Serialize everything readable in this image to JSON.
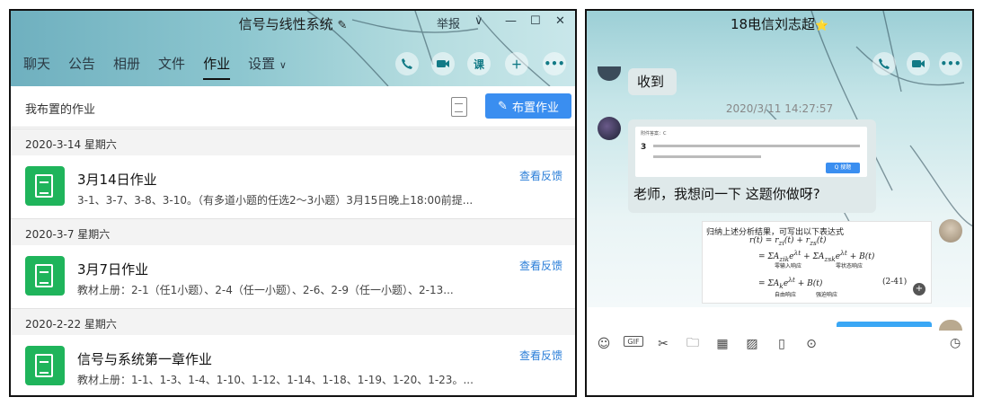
{
  "left": {
    "title": "信号与线性系统",
    "edit_icon": "pencil-icon",
    "report_label": "举报",
    "tabs": [
      "聊天",
      "公告",
      "相册",
      "文件",
      "作业",
      "设置"
    ],
    "active_tab": "作业",
    "right_buttons": [
      "phone-icon",
      "video-icon",
      "lesson-icon",
      "plus-icon",
      "more-icon"
    ],
    "lesson_label": "课",
    "subheader": "我布置的作业",
    "assign_button": "布置作业",
    "groups": [
      {
        "date": "2020-3-14 星期六",
        "title": "3月14日作业",
        "desc": "3-1、3-7、3-8、3-10。（有多道小题的任选2～3小题）3月15日晚上18:00前提...",
        "action": "查看反馈"
      },
      {
        "date": "2020-3-7 星期六",
        "title": "3月7日作业",
        "desc": "教材上册：2-1（任1小题）、2-4（任一小题）、2-6、2-9（任一小题）、2-13...",
        "action": "查看反馈"
      },
      {
        "date": "2020-2-22 星期六",
        "title": "信号与系统第一章作业",
        "desc": "教材上册：1-1、1-3、1-4、1-10、1-12、1-14、1-18、1-19、1-20、1-23。...",
        "action": "查看反馈"
      }
    ]
  },
  "right": {
    "title": "18电信刘志超",
    "badge": "⭐",
    "msg1": "收到",
    "timestamp": "2020/3/11 14:27:57",
    "img_label": "附件答案：C",
    "img_num": "3",
    "img_btn": "Q 搜题",
    "msg2": "老师，我想问一下 这题你做呀?",
    "math_title": "归纳上述分析结果，可写出以下表达式",
    "math_eq_no": "(2-41)",
    "math_zi": "零输入响应",
    "math_zs": "零状态响应",
    "math_free": "自由响应",
    "math_forced": "强迫响应",
    "toolbar": [
      "emoji-icon",
      "gif-icon",
      "scissors-icon",
      "folder-icon",
      "image-gallery-icon",
      "image-icon",
      "shake-icon",
      "more-icon",
      "history-icon"
    ],
    "gif_label": "GIF"
  }
}
